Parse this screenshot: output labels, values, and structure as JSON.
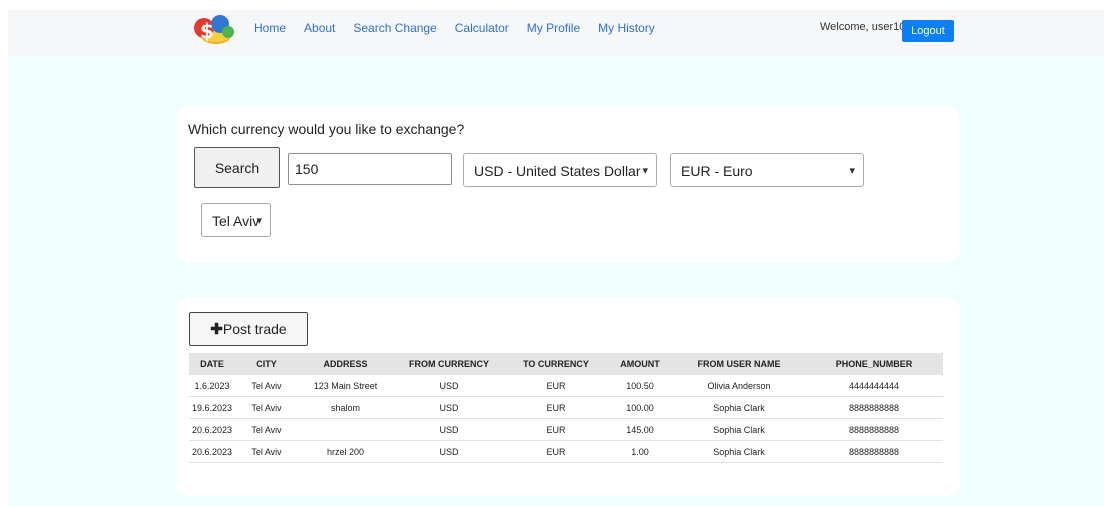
{
  "nav": {
    "links": [
      "Home",
      "About",
      "Search Change",
      "Calculator",
      "My Profile",
      "My History"
    ],
    "welcome": "Welcome, user10!",
    "logout": "Logout"
  },
  "search": {
    "question": "Which currency would you like to exchange?",
    "search_label": "Search",
    "amount": "150",
    "from_currency": "USD - United States Dollar",
    "to_currency": "EUR - Euro",
    "city": "Tel Aviv"
  },
  "trades": {
    "post_label": "Post trade",
    "headers": [
      "DATE",
      "CITY",
      "ADDRESS",
      "FROM CURRENCY",
      "TO CURRENCY",
      "AMOUNT",
      "FROM USER NAME",
      "PHONE_NUMBER"
    ],
    "rows": [
      [
        "1.6.2023",
        "Tel Aviv",
        "123 Main Street",
        "USD",
        "EUR",
        "100.50",
        "Olivia Anderson",
        "4444444444"
      ],
      [
        "19.6.2023",
        "Tel Aviv",
        "shalom",
        "USD",
        "EUR",
        "100.00",
        "Sophia Clark",
        "8888888888"
      ],
      [
        "20.6.2023",
        "Tel Aviv",
        "",
        "USD",
        "EUR",
        "145.00",
        "Sophia Clark",
        "8888888888"
      ],
      [
        "20.6.2023",
        "Tel Aviv",
        "hrzel 200",
        "USD",
        "EUR",
        "1.00",
        "Sophia Clark",
        "8888888888"
      ]
    ]
  },
  "colors": {
    "page_bg": "#f1fefe",
    "nav_bg": "#f5f7f9",
    "link": "#2f6fdd",
    "logout_bg": "#0d7ff6"
  },
  "icons": {
    "logo": "currency-coins-logo",
    "select_arrow": "chevron-down-icon",
    "post": "plus-icon"
  }
}
